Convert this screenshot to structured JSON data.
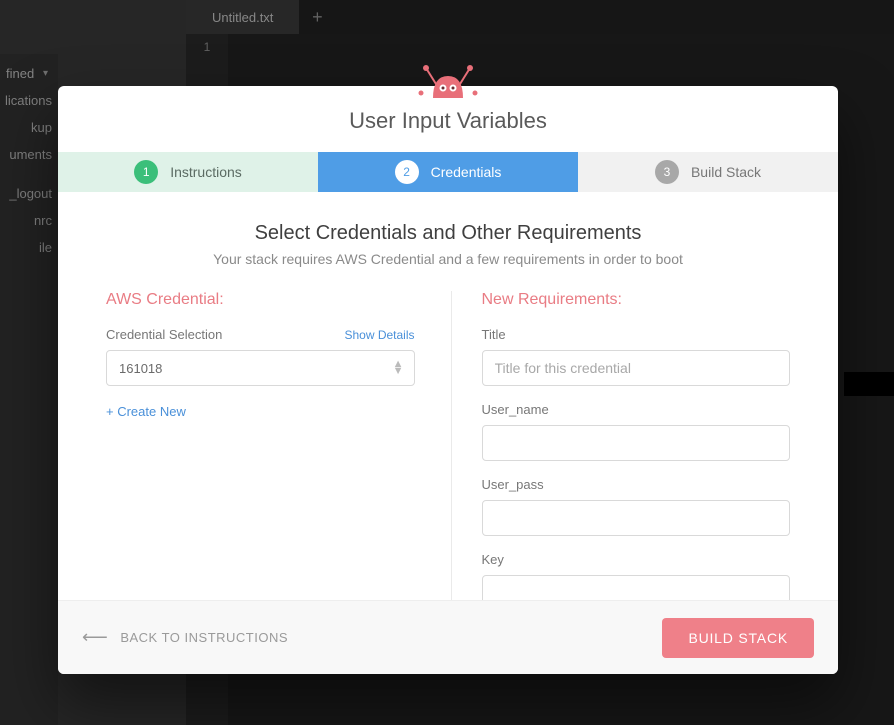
{
  "editor": {
    "tab_label": "Untitled.txt",
    "add_tab_glyph": "+",
    "line_number": "1",
    "sidebar_select": "fined",
    "tree_items": [
      "lications",
      "kup",
      "uments",
      "",
      "_logout",
      "nrc",
      "ile"
    ]
  },
  "modal": {
    "title": "User Input Variables",
    "steps": [
      {
        "num": "1",
        "label": "Instructions"
      },
      {
        "num": "2",
        "label": "Credentials"
      },
      {
        "num": "3",
        "label": "Build Stack"
      }
    ],
    "body_title": "Select Credentials and Other Requirements",
    "body_sub": "Your stack requires AWS Credential and a few requirements in order to boot",
    "aws": {
      "section": "AWS Credential:",
      "label": "Credential Selection",
      "show_details": "Show Details",
      "selected": "161018",
      "create_new": "+ Create New"
    },
    "req": {
      "section": "New Requirements:",
      "fields": [
        {
          "label": "Title",
          "placeholder": "Title for this credential"
        },
        {
          "label": "User_name",
          "placeholder": ""
        },
        {
          "label": "User_pass",
          "placeholder": ""
        },
        {
          "label": "Key",
          "placeholder": ""
        }
      ]
    },
    "footer": {
      "back": "BACK TO INSTRUCTIONS",
      "build": "BUILD STACK"
    }
  }
}
